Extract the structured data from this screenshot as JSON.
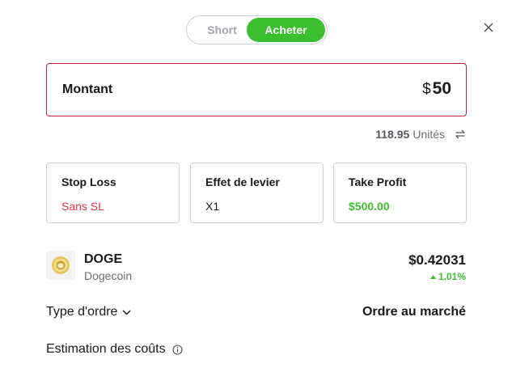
{
  "toggle": {
    "short_label": "Short",
    "buy_label": "Acheter"
  },
  "amount": {
    "label": "Montant",
    "currency": "$",
    "value": "50"
  },
  "units": {
    "value": "118.95",
    "label": "Unités"
  },
  "cards": {
    "stop_loss": {
      "title": "Stop Loss",
      "value": "Sans SL"
    },
    "leverage": {
      "title": "Effet de levier",
      "value": "X1"
    },
    "take_profit": {
      "title": "Take Profit",
      "value": "$500.00"
    }
  },
  "instrument": {
    "symbol": "DOGE",
    "name": "Dogecoin",
    "price": "$0.42031",
    "change": "1.01%"
  },
  "order": {
    "type_label": "Type d'ordre",
    "type_value": "Ordre au marché"
  },
  "costs": {
    "label": "Estimation des coûts"
  },
  "colors": {
    "accent_green": "#3bbf2f",
    "alert_red": "#e0343f",
    "border_red": "#c21f3a"
  },
  "icons": [
    "close-icon",
    "swap-icon",
    "dogecoin-logo-icon",
    "chevron-down-icon",
    "info-icon",
    "up-arrow-icon"
  ]
}
